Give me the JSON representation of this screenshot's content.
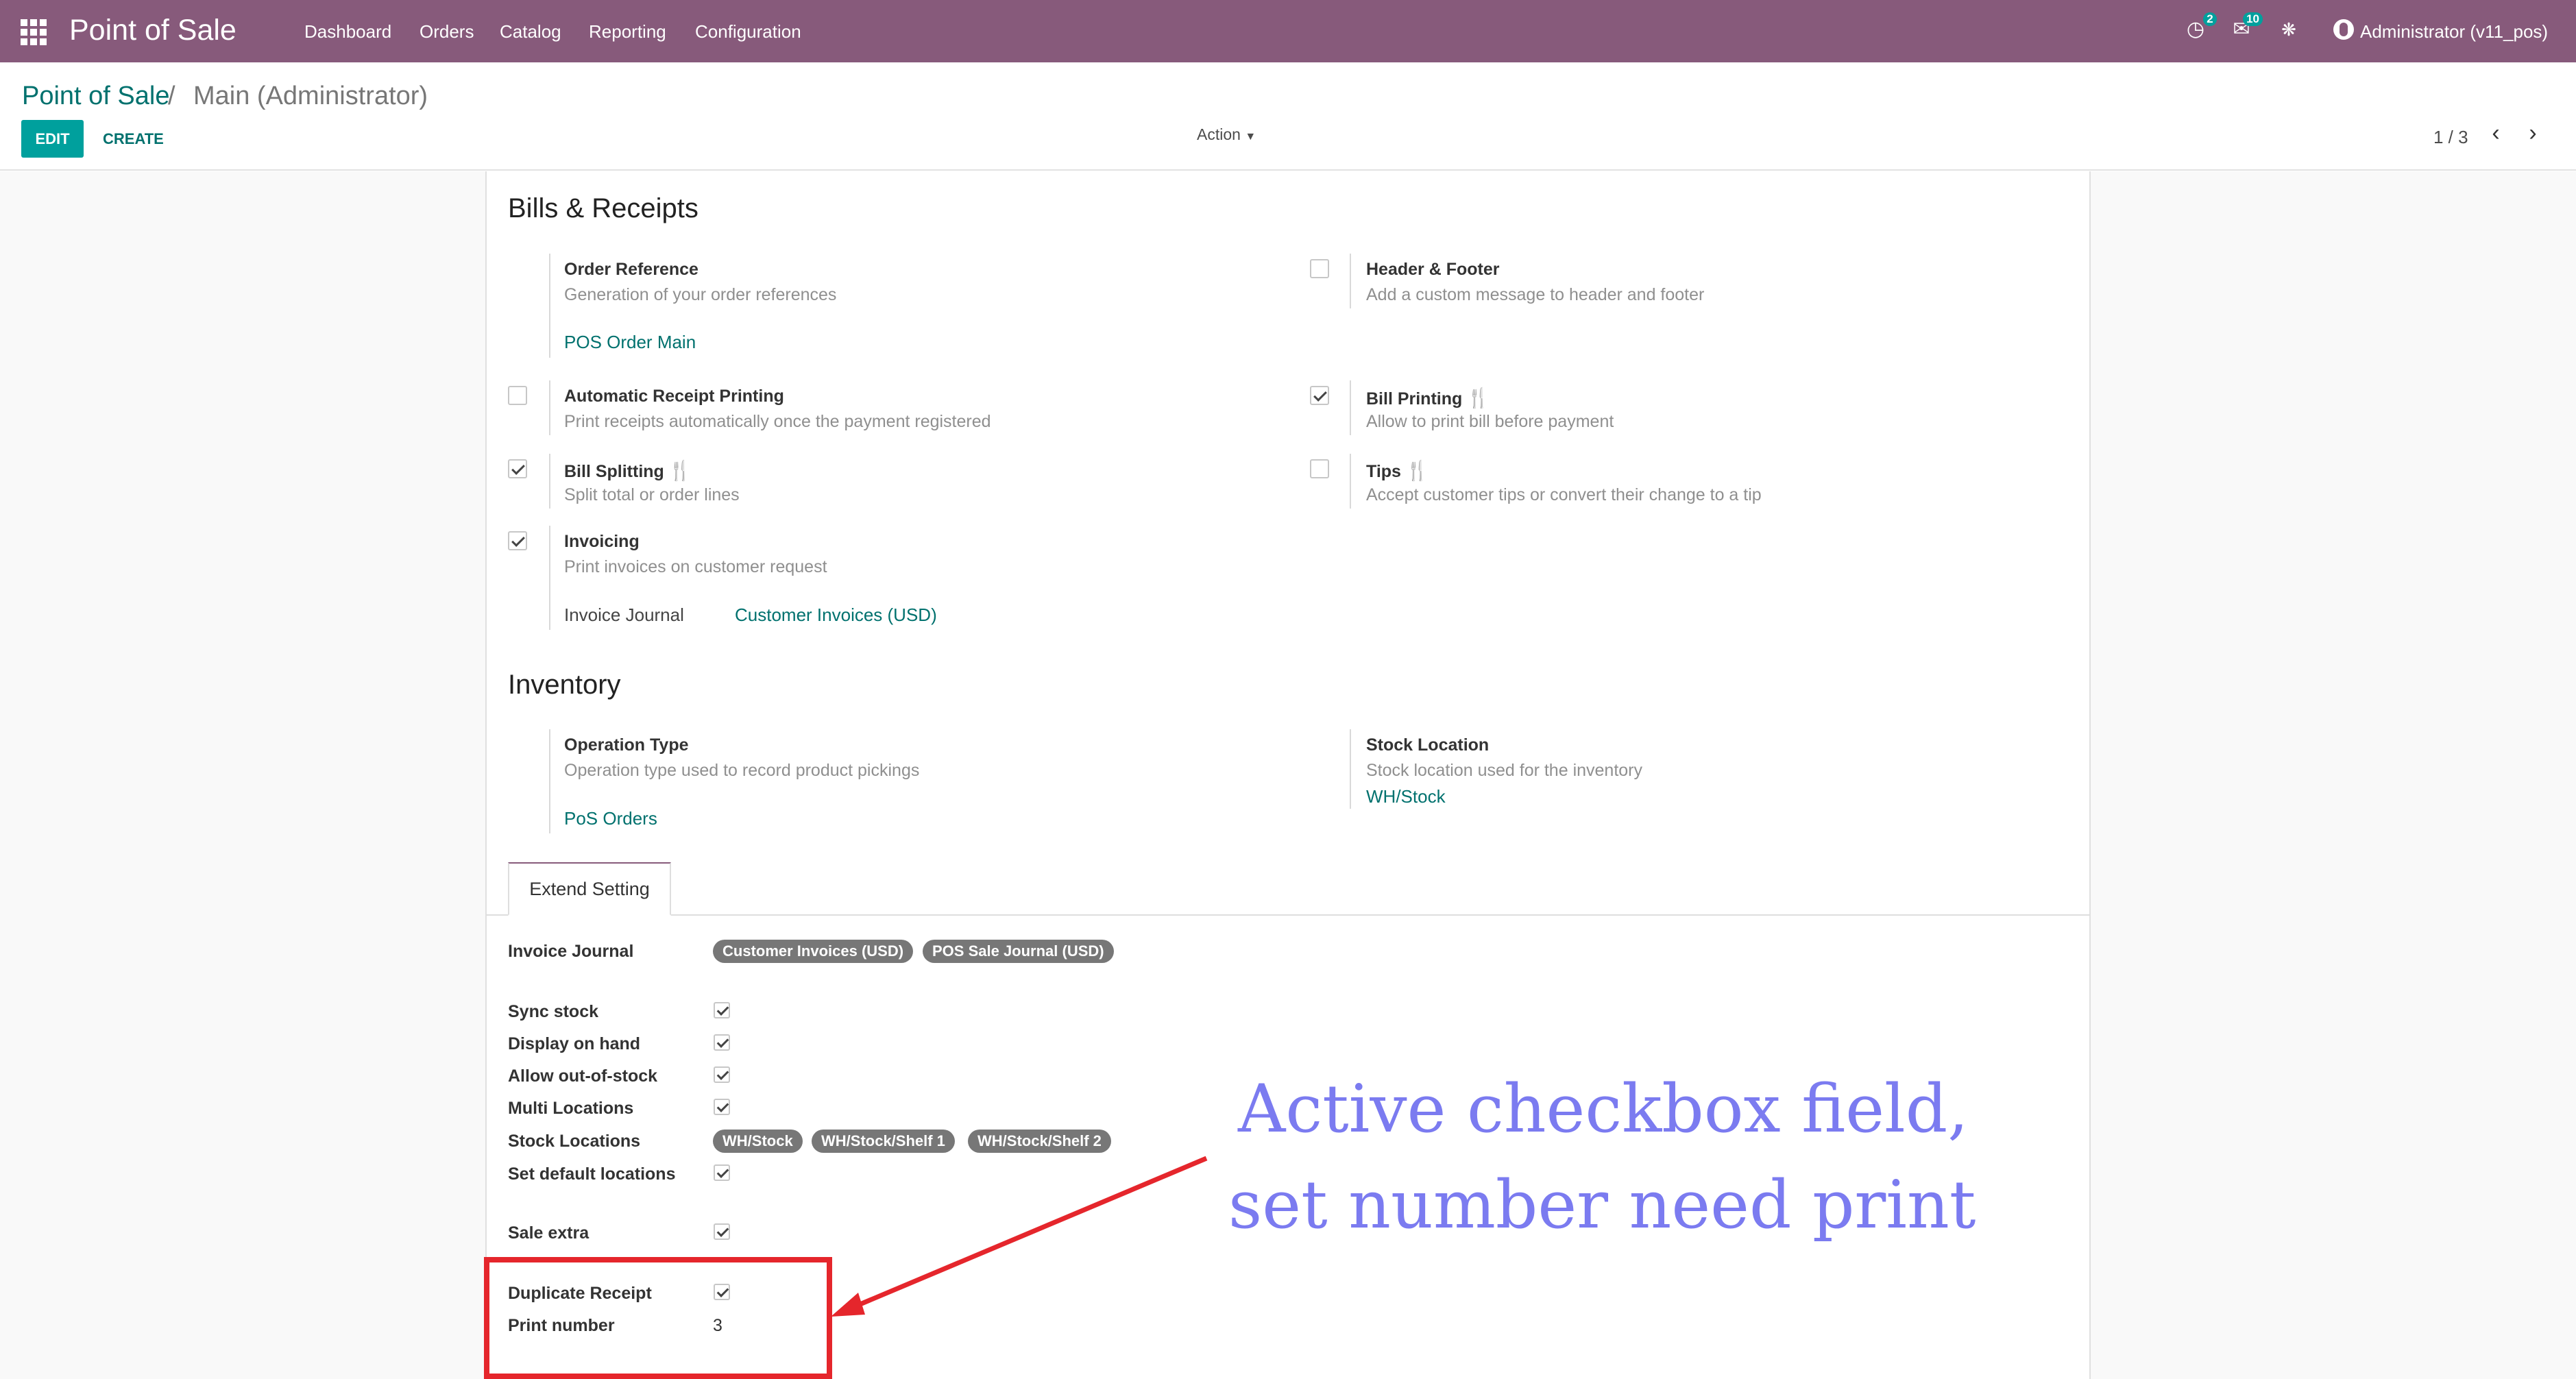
{
  "navbar": {
    "app_title": "Point of Sale",
    "menu": [
      "Dashboard",
      "Orders",
      "Catalog",
      "Reporting",
      "Configuration"
    ],
    "activity_count": "2",
    "messages_count": "10",
    "user": "Administrator (v11_pos)"
  },
  "breadcrumb": {
    "root": "Point of Sale",
    "separator": "/",
    "current": "Main (Administrator)"
  },
  "toolbar": {
    "edit_label": "EDIT",
    "create_label": "CREATE",
    "action_label": "Action"
  },
  "pager": {
    "value": "1 / 3"
  },
  "bills_receipts": {
    "title": "Bills & Receipts",
    "order_reference": {
      "label": "Order Reference",
      "desc": "Generation of your order references",
      "value": "POS Order Main"
    },
    "header_footer": {
      "label": "Header & Footer",
      "desc": "Add a custom message to header and footer",
      "checked": false
    },
    "auto_receipt": {
      "label": "Automatic Receipt Printing",
      "desc": "Print receipts automatically once the payment registered",
      "checked": false
    },
    "bill_printing": {
      "label": "Bill Printing",
      "desc": "Allow to print bill before payment",
      "checked": true
    },
    "bill_splitting": {
      "label": "Bill Splitting",
      "desc": "Split total or order lines",
      "checked": true
    },
    "tips": {
      "label": "Tips",
      "desc": "Accept customer tips or convert their change to a tip",
      "checked": false
    },
    "invoicing": {
      "label": "Invoicing",
      "desc": "Print invoices on customer request",
      "checked": true,
      "journal_label": "Invoice Journal",
      "journal_value": "Customer Invoices (USD)"
    }
  },
  "inventory": {
    "title": "Inventory",
    "operation_type": {
      "label": "Operation Type",
      "desc": "Operation type used to record product pickings",
      "value": "PoS Orders"
    },
    "stock_location": {
      "label": "Stock Location",
      "desc": "Stock location used for the inventory",
      "value": "WH/Stock"
    }
  },
  "tabs": [
    "Extend Setting"
  ],
  "extend": {
    "invoice_journal_label": "Invoice Journal",
    "invoice_journal_tags": [
      "Customer Invoices (USD)",
      "POS Sale Journal (USD)"
    ],
    "sync_stock_label": "Sync stock",
    "display_on_hand_label": "Display on hand",
    "allow_oos_label": "Allow out-of-stock",
    "multi_locations_label": "Multi Locations",
    "stock_locations_label": "Stock Locations",
    "stock_locations_tags": [
      "WH/Stock",
      "WH/Stock/Shelf 1",
      "WH/Stock/Shelf 2"
    ],
    "default_locations_label": "Set default locations",
    "sale_extra_label": "Sale extra",
    "duplicate_receipt_label": "Duplicate Receipt",
    "print_number_label": "Print number",
    "print_number": "3"
  },
  "annotation": {
    "line1": "Active checkbox field,",
    "line2": "set number need print",
    "color": "#7b7bf0",
    "box_color": "#e5262c"
  },
  "colors": {
    "navbar": "#875a7b",
    "primary": "#00a09d",
    "link": "#00716e"
  }
}
